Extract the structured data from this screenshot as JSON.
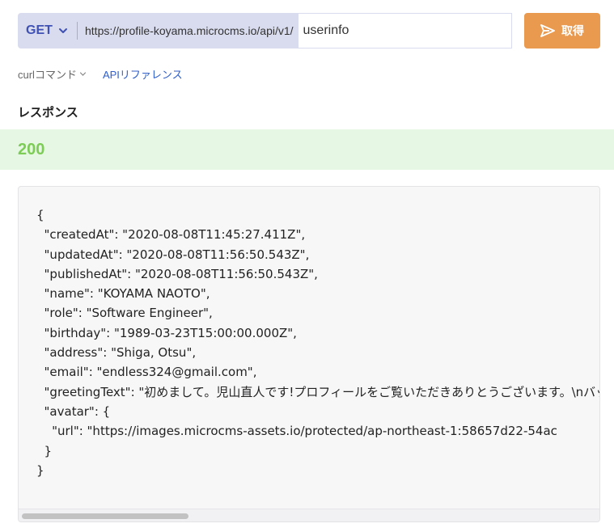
{
  "request": {
    "method": "GET",
    "base_url": "https://profile-koyama.microcms.io/api/v1/",
    "path_value": "userinfo",
    "send_label": "取得"
  },
  "tabs": {
    "curl_label": "curlコマンド",
    "api_reference_label": "APIリファレンス"
  },
  "response": {
    "heading": "レスポンス",
    "status_code": "200",
    "json_lines": [
      "{",
      "  \"createdAt\": \"2020-08-08T11:45:27.411Z\",",
      "  \"updatedAt\": \"2020-08-08T11:56:50.543Z\",",
      "  \"publishedAt\": \"2020-08-08T11:56:50.543Z\",",
      "  \"name\": \"KOYAMA NAOTO\",",
      "  \"role\": \"Software Engineer\",",
      "  \"birthday\": \"1989-03-23T15:00:00.000Z\",",
      "  \"address\": \"Shiga, Otsu\",",
      "  \"email\": \"endless324@gmail.com\",",
      "  \"greetingText\": \"初めまして。児山直人です!プロフィールをご覧いただきありとうございます。\\nバッ",
      "  \"avatar\": {",
      "    \"url\": \"https://images.microcms-assets.io/protected/ap-northeast-1:58657d22-54ac",
      "  }",
      "}"
    ]
  },
  "colors": {
    "method_bg": "#d9dcee",
    "method_text": "#3f51b5",
    "send_bg": "#ea9a4e",
    "link": "#2f5ec8",
    "status_bg": "#e6f8e3",
    "status_text": "#7ccc56",
    "panel_bg": "#f7f7f8"
  },
  "icons": {
    "method_dropdown": "chevron-down-icon",
    "send": "send-icon",
    "curl_dropdown": "chevron-down-icon"
  }
}
